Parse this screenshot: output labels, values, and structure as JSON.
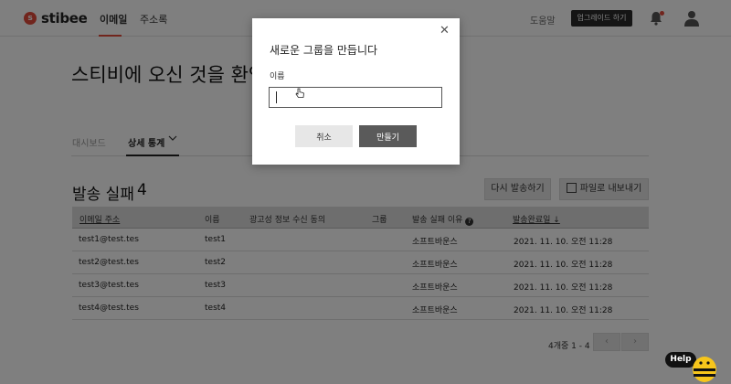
{
  "app": {
    "logo_text": "stibee"
  },
  "nav": {
    "tabs": [
      {
        "label": "이메일"
      },
      {
        "label": "주소록"
      }
    ],
    "help_label": "도움말",
    "upgrade_label": "업그레이드 하기"
  },
  "welcome": {
    "text": "스티비에 오신 것을 환영합니다"
  },
  "subtabs": [
    {
      "label": "대시보드"
    },
    {
      "label": "상세 통계"
    }
  ],
  "section": {
    "title": "발송 실패",
    "count": "4",
    "resend_label": "다시 발송하기",
    "export_label": "파일로 내보내기"
  },
  "table": {
    "headers": [
      "이메일 주소",
      "이름",
      "광고성 정보 수신 동의",
      "그룹",
      "발송 실패 이유",
      "발송완료일 ↓"
    ],
    "rows": [
      {
        "email": "test1@test.tes",
        "name": "test1",
        "reason": "소프트바운스",
        "date": "2021. 11. 10. 오전 11:28"
      },
      {
        "email": "test2@test.tes",
        "name": "test2",
        "reason": "소프트바운스",
        "date": "2021. 11. 10. 오전 11:28"
      },
      {
        "email": "test3@test.tes",
        "name": "test3",
        "reason": "소프트바운스",
        "date": "2021. 11. 10. 오전 11:28"
      },
      {
        "email": "test4@test.tes",
        "name": "test4",
        "reason": "소프트바운스",
        "date": "2021. 11. 10. 오전 11:28"
      }
    ]
  },
  "pagination": {
    "text": "4개중 1 - 4"
  },
  "modal": {
    "title": "새로운 그룹을 만듭니다",
    "name_label": "이름",
    "name_value": "",
    "cancel_label": "취소",
    "create_label": "만들기"
  },
  "help_widget": {
    "label": "Help"
  },
  "colors": {
    "brand": "#e24a3b",
    "primary_button": "#5a5a5a",
    "overlay": "rgba(0,0,0,0.5)"
  }
}
